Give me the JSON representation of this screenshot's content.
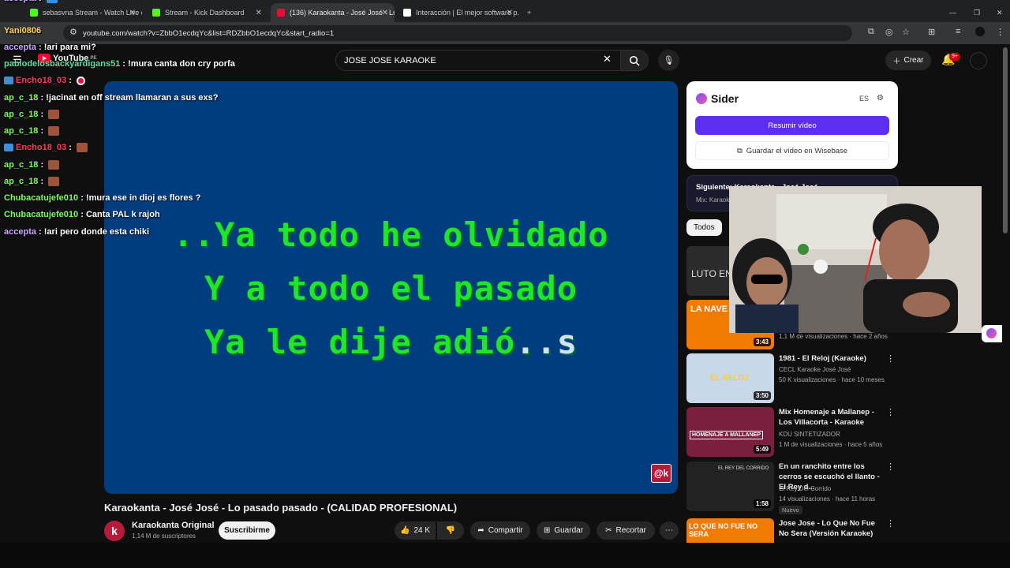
{
  "browser": {
    "tabs": [
      {
        "label": "sebasvna Stream - Watch Live on...",
        "color": "#53fc18"
      },
      {
        "label": "Stream - Kick Dashboard",
        "color": "#53fc18"
      },
      {
        "label": "(136) Karaokanta - José José - Lo...",
        "color": "#ff0033"
      },
      {
        "label": "Interacción | El mejor software p...",
        "color": "#ffffff"
      }
    ],
    "url": "youtube.com/watch?v=ZbbO1ecdqYc&list=RDZbbO1ecdqYc&start_radio=1"
  },
  "youtube": {
    "logo": "YouTube",
    "logo_region": "PE",
    "search_value": "JOSE JOSE KARAOKE",
    "create_label": "Crear",
    "notif_badge": "9+"
  },
  "video": {
    "lyric_lines": [
      {
        "sung": "..Ya todo he olvidado",
        "pending": ""
      },
      {
        "sung": "Y a todo el pasado",
        "pending": ""
      },
      {
        "sung": "Ya le dije adió",
        "pending": "..s"
      }
    ],
    "watermark": "@k",
    "title": "Karaokanta - José José - Lo pasado pasado - (CALIDAD PROFESIONAL)",
    "channel_name": "Karaokanta Original",
    "channel_initial": "k",
    "channel_subs": "1,14 M de suscriptores",
    "subscribe_label": "Suscribirme",
    "likes": "24 K",
    "share_label": "Compartir",
    "save_label": "Guardar",
    "clip_label": "Recortar"
  },
  "sider": {
    "name": "Sider",
    "lang": "ES",
    "summarize_label": "Resumir vídeo",
    "save_label": "Guardar el vídeo en Wisebase"
  },
  "next": {
    "label": "Siguiente: Karaokanta - José José - ...",
    "sub": "Mix: Karaok..."
  },
  "chips": {
    "all": "Todos"
  },
  "recommendations": [
    {
      "thumb_text": "LUTO EN",
      "title": "",
      "channel": "",
      "meta": "",
      "duration": "",
      "bg": "#2b2b2b"
    },
    {
      "thumb_text": "LA NAVE D",
      "title": "",
      "channel": "",
      "meta": "1,1 M de visualizaciones · hace 2 años",
      "duration": "3:43",
      "bg": "#f07b00"
    },
    {
      "thumb_text": "EL RELOJ",
      "title": "1981 - El Reloj (Karaoke)",
      "channel": "CECL Karaoke José José",
      "meta": "50 K visualizaciones · hace 10 meses",
      "duration": "3:50",
      "bg": "#c8d8e8"
    },
    {
      "thumb_text": "HOMENAJE A MALLANEP",
      "title": "Mix Homenaje a Mallanep - Los Villacorta - Karaoke",
      "channel": "KDU SINTETIZADOR",
      "meta": "1 M de visualizaciones · hace 5 años",
      "duration": "5:49",
      "bg": "#7a1f3d"
    },
    {
      "thumb_text": "EL REY DEL CORRIDO",
      "title": "En un ranchito entre los cerros se escuchó el llanto - El Rey d...",
      "channel": "El Rey Del Corrido",
      "meta": "14 visualizaciones · hace 11 horas",
      "duration": "1:58",
      "bg": "#222222",
      "badge": "Nuevo"
    },
    {
      "thumb_text": "LO QUE NO FUE NO SERA",
      "title": "Jose Jose - Lo Que No Fue No Sera (Versión Karaoke)",
      "channel": "",
      "meta": "",
      "duration": "",
      "bg": "#f07b00"
    }
  ],
  "chat": [
    {
      "user": "accepta",
      "color": "#c7a6ff",
      "msg": "",
      "emote": true
    },
    {
      "user": "Yani0806",
      "color": "#ffd35a",
      "msg": ""
    },
    {
      "user": "accepta",
      "color": "#c7a6ff",
      "msg": "!ari para mi?"
    },
    {
      "user": "pablodelosbackyardigans51",
      "color": "#60e0a0",
      "msg": "!mura canta don cry porfa"
    },
    {
      "user": "Encho18_03",
      "color": "#ff3b5c",
      "msg": "",
      "kick": true,
      "dot": true
    },
    {
      "user": "ap_c_18",
      "color": "#7dff5a",
      "msg": "!jacinat en off stream llamaran a sus exs?"
    },
    {
      "user": "ap_c_18",
      "color": "#7dff5a",
      "msg": "",
      "emote": true
    },
    {
      "user": "ap_c_18",
      "color": "#7dff5a",
      "msg": "",
      "emote": true
    },
    {
      "user": "Encho18_03",
      "color": "#ff3b5c",
      "msg": "",
      "kick": true,
      "emote": true
    },
    {
      "user": "ap_c_18",
      "color": "#7dff5a",
      "msg": "",
      "emote": true
    },
    {
      "user": "ap_c_18",
      "color": "#7dff5a",
      "msg": "",
      "emote": true
    },
    {
      "user": "Chubacatujefe010",
      "color": "#7dff5a",
      "msg": "!mura ese in dioj es flores ?"
    },
    {
      "user": "Chubacatujefe010",
      "color": "#7dff5a",
      "msg": "Canta PAL k rajoh"
    },
    {
      "user": "accepta",
      "color": "#c7a6ff",
      "msg": "!ari pero donde esta chiki"
    }
  ]
}
